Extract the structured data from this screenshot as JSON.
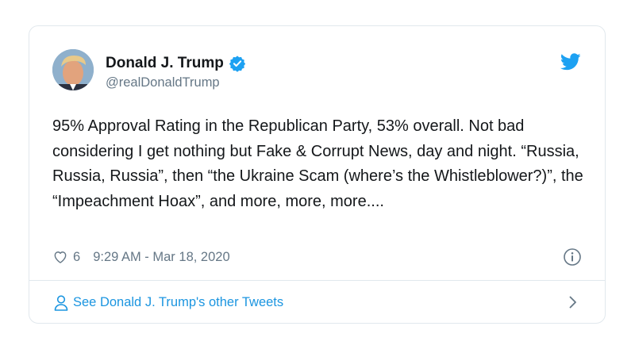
{
  "tweet": {
    "author": {
      "display_name": "Donald J. Trump",
      "handle": "@realDonaldTrump",
      "verified": true
    },
    "text": "95% Approval Rating in the Republican Party, 53% overall. Not bad considering I get nothing but Fake & Corrupt News, day and night. “Russia, Russia, Russia”, then “the Ukraine Scam (where’s the Whistleblower?)”, the “Impeachment Hoax”, and more, more, more....",
    "likes": "6",
    "timestamp": "9:29 AM - Mar 18, 2020"
  },
  "footer": {
    "label": "See Donald J. Trump's other Tweets"
  },
  "colors": {
    "brand_blue": "#1da1f2",
    "link_blue": "#1b95e0",
    "muted_gray": "#657786",
    "border": "#e1e8ed"
  },
  "icons": {
    "verified": "verified-badge-icon",
    "brand": "twitter-bird-icon",
    "like": "heart-icon",
    "info": "info-icon",
    "profile": "person-icon",
    "navigate": "chevron-right-icon"
  }
}
